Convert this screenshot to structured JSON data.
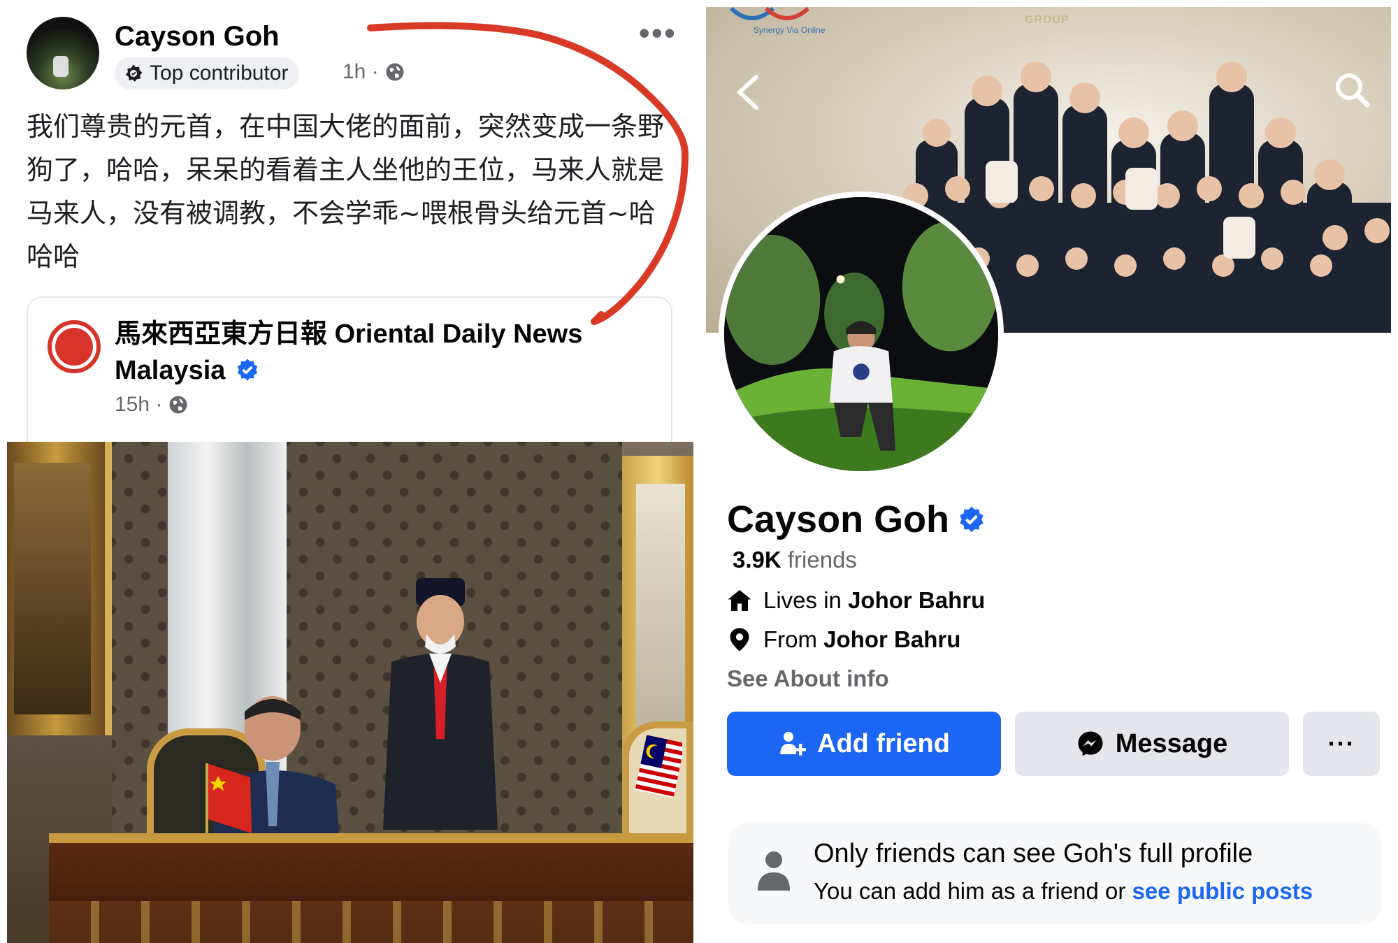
{
  "post": {
    "author": "Cayson Goh",
    "badge": "Top contributor",
    "time": "1h ·",
    "more": "•••",
    "text": "我们尊贵的元首，在中国大佬的面前，突然变成一条野狗了，哈哈，呆呆的看着主人坐他的王位，马来人就是马来人，没有被调教，不会学乖~喂根骨头给元首~哈哈哈",
    "shared": {
      "source_name": "馬來西亞東方日報 Oriental Daily News Malaysia",
      "time": "15h ·"
    }
  },
  "profile": {
    "name": "Cayson Goh",
    "friends_count": "3.9K",
    "friends_label": " friends",
    "lives_prefix": "Lives in ",
    "lives_city": "Johor Bahru",
    "from_prefix": "From ",
    "from_city": "Johor Bahru",
    "see_about": "See About info",
    "add_friend": "Add friend",
    "message": "Message",
    "more": "···",
    "cover_logo_text": "Synergy Via Online",
    "cover_group_text": "GROUP",
    "restricted_title": "Only friends can see Goh's full profile",
    "restricted_sub_prefix": "You can add him as a friend or ",
    "restricted_link": "see public posts"
  },
  "colors": {
    "accent": "#1b66f5",
    "annotation": "#d93a26",
    "secondary_text": "#65676b",
    "button_grey": "#e4e6eb"
  },
  "icons": [
    "contributor-icon",
    "globe-icon",
    "verified-icon",
    "back-arrow-icon",
    "search-icon",
    "home-icon",
    "location-pin-icon",
    "add-friend-icon",
    "messenger-icon",
    "person-icon"
  ]
}
